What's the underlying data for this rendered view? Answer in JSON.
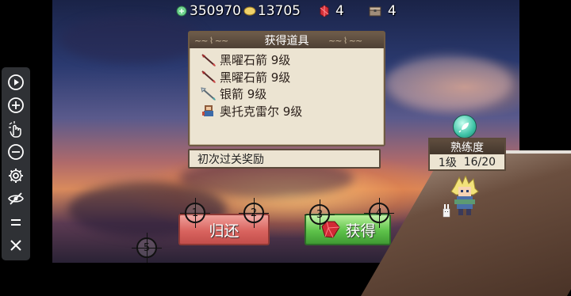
{
  "hud": {
    "coins": "350970",
    "gold": "13705",
    "gems": "4",
    "chests": "4"
  },
  "panel": {
    "title": "获得道具",
    "items": [
      {
        "name": "黑曜石箭 9级",
        "icon": "obsidian-arrow-icon"
      },
      {
        "name": "黑曜石箭 9级",
        "icon": "obsidian-arrow-icon"
      },
      {
        "name": "银箭 9级",
        "icon": "silver-arrow-icon"
      },
      {
        "name": "奥托克雷尔 9级",
        "icon": "otto-creel-icon"
      }
    ]
  },
  "reward_label": "初次过关奖励",
  "proficiency": {
    "title": "熟练度",
    "level": "1级",
    "progress": "16/20"
  },
  "buttons": {
    "return": "归还",
    "obtain": "获得"
  },
  "markers": [
    "1",
    "2",
    "3",
    "4",
    "5"
  ],
  "toolbar_icons": [
    "play-icon",
    "zoom-in-icon",
    "hand-pointer-icon",
    "zoom-out-icon",
    "gear-icon",
    "eye-off-icon",
    "menu-icon",
    "close-icon"
  ],
  "colors": {
    "return_button": "#d9645f",
    "obtain_button": "#5ec24a",
    "panel_header": "#5f4d3e",
    "panel_bg": "#ece4d2"
  }
}
